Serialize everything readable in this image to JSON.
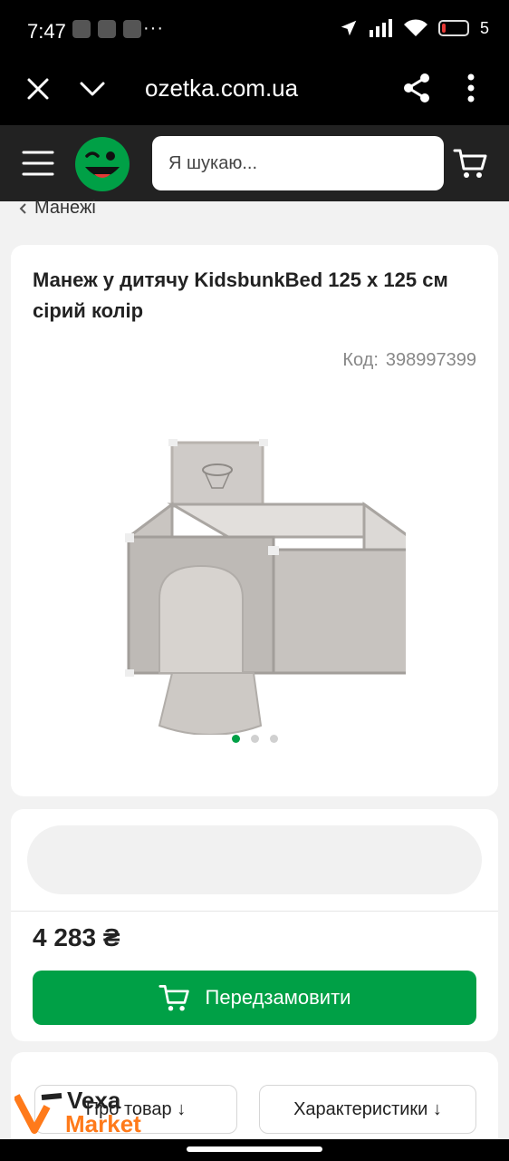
{
  "status_bar": {
    "time": "7:47",
    "dots": "···",
    "battery": "5"
  },
  "browser": {
    "url": "ozetka.com.ua"
  },
  "header": {
    "search_placeholder": "Я шукаю..."
  },
  "breadcrumb": {
    "label": "Манежі"
  },
  "product": {
    "title": "Манеж у дитячу KidsbunkBed 125 x 125 см сірий колір",
    "code_label": "Код:",
    "code_value": "398997399",
    "image_count": 3,
    "active_image": 1
  },
  "purchase": {
    "price": "4 283 ₴",
    "preorder_label": "Передзамовити"
  },
  "tabs": {
    "about": "Про товар ↓",
    "specs": "Характеристики ↓"
  },
  "watermark": {
    "line1": "Vexa",
    "line2": "Market"
  },
  "colors": {
    "brand_green": "#00a046",
    "header_dark": "#222222"
  }
}
